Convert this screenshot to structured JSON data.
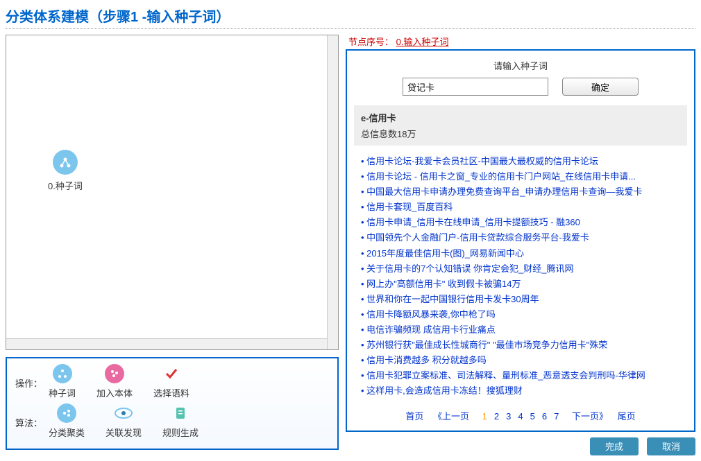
{
  "title": "分类体系建模（步骤1 -输入种子词）",
  "tree": {
    "node_label": "0.种子词"
  },
  "ops": {
    "row1_label": "操作：",
    "row2_label": "算法：",
    "items1": {
      "seed": "种子词",
      "add": "加入本体",
      "corpus": "选择语料"
    },
    "items2": {
      "cluster": "分类聚类",
      "discover": "关联发现",
      "rule": "规则生成"
    }
  },
  "right": {
    "node_header_prefix": "节点序号：",
    "node_header_value": "0.输入种子词",
    "input_label": "请输入种子词",
    "input_value": "贷记卡",
    "confirm": "确定",
    "ecard_title": "e-信用卡",
    "ecard_count": "总信息数18万",
    "links": [
      "信用卡论坛-我爱卡会员社区-中国最大最权威的信用卡论坛",
      "信用卡论坛 - 信用卡之窗_专业的信用卡门户网站_在线信用卡申请...",
      "中国最大信用卡申请办理免费查询平台_申请办理信用卡查询—我爱卡",
      "信用卡套现_百度百科",
      "信用卡申请_信用卡在线申请_信用卡提额技巧 - 融360",
      "中国领先个人金融门户-信用卡贷款综合服务平台-我爱卡",
      "2015年度最佳信用卡(图)_网易新闻中心",
      "关于信用卡的7个认知错误 你肯定会犯_财经_腾讯网",
      "网上办\"高额信用卡\" 收到假卡被骗14万",
      "世界和你在一起中国银行信用卡发卡30周年",
      "信用卡降额风暴来袭,你中枪了吗",
      "电信诈骗频现 成信用卡行业痛点",
      "苏州银行获\"最佳成长性城商行\" \"最佳市场竞争力信用卡\"殊荣",
      "信用卡消费越多 积分就越多吗",
      "信用卡犯罪立案标准、司法解释、量刑标准_恶意透支会判刑吗-华律网",
      "这样用卡,会造成信用卡冻结！搜狐理财"
    ],
    "pager": {
      "first": "首页",
      "prev": "《上一页",
      "pages": [
        "1",
        "2",
        "3",
        "4",
        "5",
        "6",
        "7"
      ],
      "current": "1",
      "next": "下一页》",
      "last": "尾页"
    },
    "finish": "完成",
    "cancel": "取消"
  }
}
